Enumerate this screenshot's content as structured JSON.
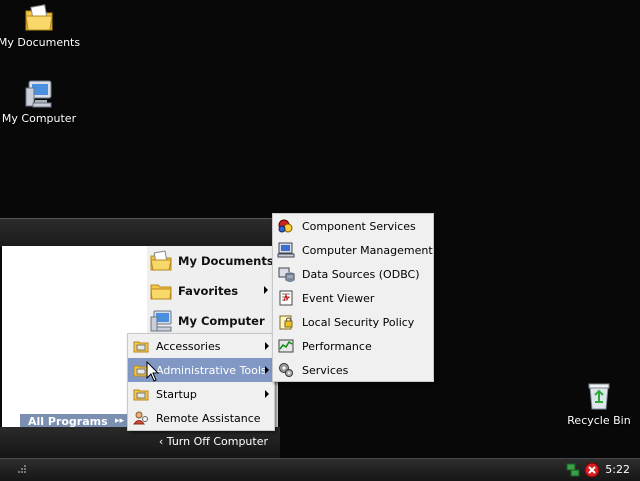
{
  "desktop": {
    "icons": [
      {
        "label": "My Documents",
        "icon": "folder-documents-icon"
      },
      {
        "label": "My Computer",
        "icon": "computer-icon"
      },
      {
        "label": "Recycle Bin",
        "icon": "recycle-bin-icon"
      }
    ]
  },
  "start_menu": {
    "places": [
      {
        "label": "My Documents",
        "icon": "folder-documents-icon",
        "submenu": false
      },
      {
        "label": "Favorites",
        "icon": "folder-icon",
        "submenu": true
      },
      {
        "label": "My Computer",
        "icon": "computer-icon",
        "submenu": false
      }
    ],
    "all_programs_label": "All Programs",
    "turn_off_label": "Turn Off Computer"
  },
  "programs_menu": {
    "items": [
      {
        "label": "Accessories",
        "icon": "program-group-icon",
        "submenu": true,
        "highlighted": false
      },
      {
        "label": "Administrative Tools",
        "icon": "program-group-icon",
        "submenu": true,
        "highlighted": true
      },
      {
        "label": "Startup",
        "icon": "program-group-icon",
        "submenu": true,
        "highlighted": false
      },
      {
        "label": "Remote Assistance",
        "icon": "remote-assistance-icon",
        "submenu": false,
        "highlighted": false
      }
    ]
  },
  "admin_tools_menu": {
    "items": [
      {
        "label": "Component Services",
        "icon": "component-services-icon"
      },
      {
        "label": "Computer Management",
        "icon": "computer-management-icon"
      },
      {
        "label": "Data Sources (ODBC)",
        "icon": "data-sources-icon"
      },
      {
        "label": "Event Viewer",
        "icon": "event-viewer-icon"
      },
      {
        "label": "Local Security Policy",
        "icon": "security-policy-icon"
      },
      {
        "label": "Performance",
        "icon": "performance-icon"
      },
      {
        "label": "Services",
        "icon": "services-icon"
      }
    ]
  },
  "taskbar": {
    "clock": "5:22",
    "tray_icons": [
      "network-icon",
      "security-alert-icon"
    ]
  },
  "colors": {
    "desktop_bg": "#080808",
    "highlight": "#8098c3",
    "all_programs_bg": "#7b8fb0"
  }
}
